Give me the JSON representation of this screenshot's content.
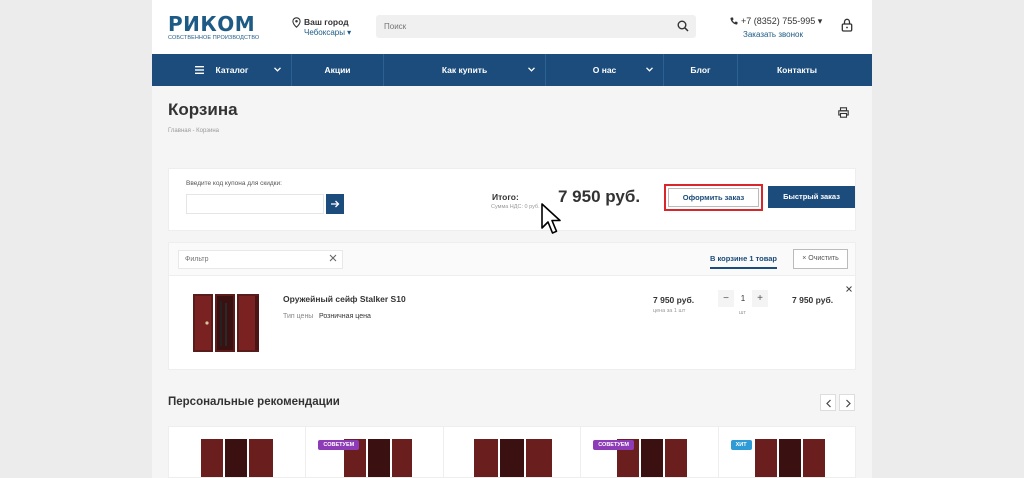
{
  "header": {
    "logo_text": "РИКОМ",
    "logo_subtitle": "СОБСТВЕННОЕ ПРОИЗВОДСТВО",
    "city_label": "Ваш город",
    "city_value": "Чебоксары ▾",
    "search_placeholder": "Поиск",
    "phone": "+7 (8352) 755-995 ▾",
    "callback": "Заказать звонок",
    "icons": {
      "city": "location-pin-icon",
      "search": "search-icon",
      "phone": "phone-icon",
      "cart": "lock-icon"
    }
  },
  "nav": {
    "items": [
      {
        "label": "Каталог",
        "dropdown": true,
        "burger": true
      },
      {
        "label": "Акции",
        "dropdown": false
      },
      {
        "label": "Как купить",
        "dropdown": true
      },
      {
        "label": "О нас",
        "dropdown": true
      },
      {
        "label": "Блог",
        "dropdown": false
      },
      {
        "label": "Контакты",
        "dropdown": false
      }
    ]
  },
  "page": {
    "title": "Корзина",
    "breadcrumb": "Главная  -  Корзина"
  },
  "summary": {
    "coupon_label": "Введите код купона для скидки:",
    "coupon_value": "",
    "total_label": "Итого:",
    "vat_label": "Сумма НДС: 0 руб.",
    "total_value": "7 950 руб.",
    "checkout_label": "Оформить заказ",
    "quick_order_label": "Быстрый заказ"
  },
  "basket": {
    "filter_placeholder": "Фильтр",
    "tab_label": "В корзине 1 товар",
    "clear_label": "× Очистить",
    "items": [
      {
        "name": "Оружейный сейф Stalker S10",
        "price_type_label": "Тип цены",
        "price_type_value": "Розничная цена",
        "unit_price": "7 950 руб.",
        "unit_note": "цена за 1 шт",
        "quantity": "1",
        "quantity_unit": "шт",
        "minus": "−",
        "plus": "+",
        "total": "7 950 руб."
      }
    ]
  },
  "recommendations": {
    "title": "Персональные рекомендации",
    "cards": [
      {
        "badge": ""
      },
      {
        "badge": "СОВЕТУЕМ"
      },
      {
        "badge": ""
      },
      {
        "badge": "СОВЕТУЕМ"
      },
      {
        "badge": "ХИТ"
      }
    ]
  },
  "colors": {
    "brand": "#1d5b86",
    "nav_bg": "#1b4c7b",
    "highlight": "#d9262b",
    "badge_recommend": "#8e3bb8",
    "badge_hit": "#2f9bd6"
  }
}
